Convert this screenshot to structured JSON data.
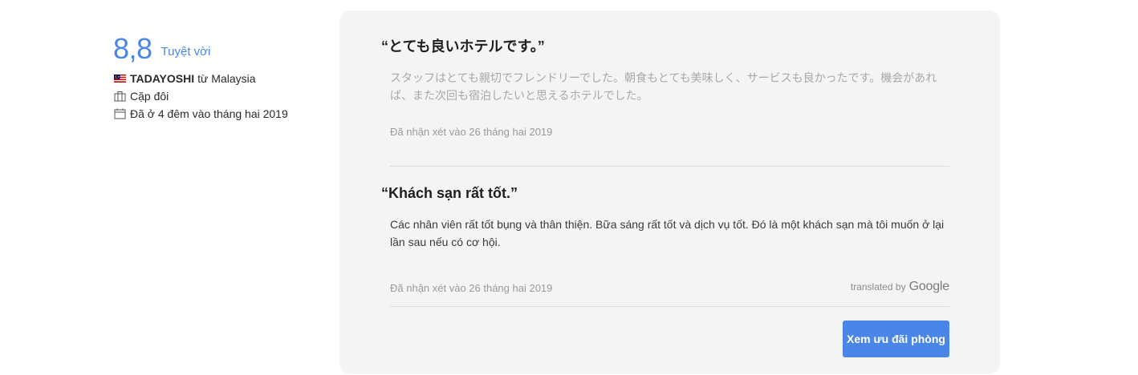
{
  "reviewer": {
    "score": "8,8",
    "score_label": "Tuyệt vời",
    "name": "TADAYOSHI",
    "origin": "từ Malaysia",
    "traveler_type": "Cặp đôi",
    "stay": "Đã ở 4 đêm vào tháng hai 2019",
    "flag_icon": "malaysia-flag-icon",
    "traveler_icon": "luggage-icon",
    "stay_icon": "calendar-icon"
  },
  "reviews": [
    {
      "title": "“とても良いホテルです。”",
      "body": "スタッフはとても親切でフレンドリーでした。朝食もとても美味しく、サービスも良かったです。機会があれば、また次回も宿泊したいと思えるホテルでした。",
      "date": "Đã nhận xét vào 26 tháng hai 2019"
    },
    {
      "title": "“Khách sạn rất tốt.”",
      "body": "Các nhân viên rất tốt bụng và thân thiện. Bữa sáng rất tốt và dịch vụ tốt. Đó là một khách sạn mà tôi muốn ở lại lần sau nếu có cơ hội.",
      "date": "Đã nhận xét vào 26 tháng hai 2019"
    }
  ],
  "translation": {
    "prefix": "translated by",
    "brand": "Google"
  },
  "cta": {
    "label": "Xem ưu đãi phòng"
  },
  "colors": {
    "accent": "#4a86e8",
    "card_bg": "#f4f4f4"
  }
}
